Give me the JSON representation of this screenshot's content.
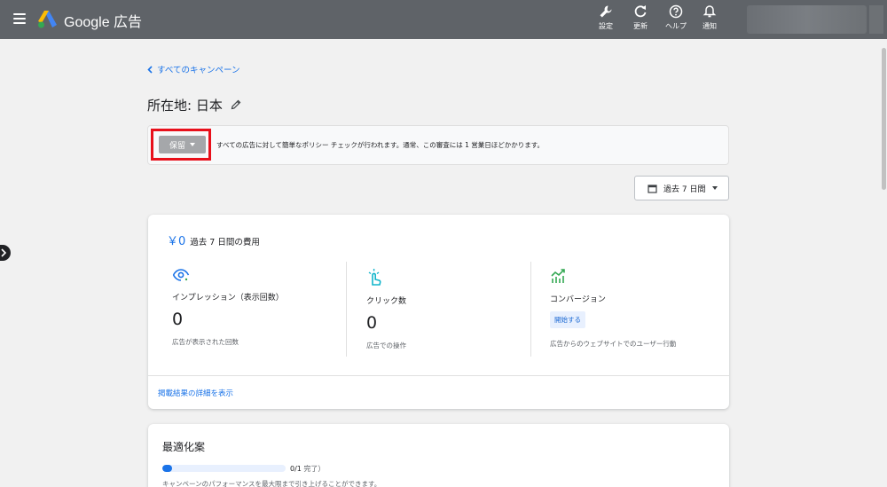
{
  "header": {
    "product_name": "Google 広告",
    "actions": [
      {
        "icon": "wrench-icon",
        "label": "設定"
      },
      {
        "icon": "refresh-icon",
        "label": "更新"
      },
      {
        "icon": "help-icon",
        "label": "ヘルプ"
      },
      {
        "icon": "bell-icon",
        "label": "通知"
      }
    ]
  },
  "nav": {
    "back_link": "すべてのキャンペーン"
  },
  "page": {
    "title": "所在地: 日本"
  },
  "status": {
    "button_label": "保留",
    "message": "すべての広告に対して簡単なポリシー チェックが行われます。通常、この審査には 1 営業日ほどかかります。"
  },
  "date_range": {
    "label": "過去 7 日間"
  },
  "summary": {
    "cost_value": "￥0",
    "cost_label": "過去 7 日間の費用",
    "metrics": [
      {
        "icon": "eye-icon",
        "name": "インプレッション（表示回数）",
        "value": "0",
        "desc": "広告が表示された回数"
      },
      {
        "icon": "click-icon",
        "name": "クリック数",
        "value": "0",
        "desc": "広告での操作"
      },
      {
        "icon": "conversion-chart-icon",
        "name": "コンバージョン",
        "badge": "開始する",
        "desc": "広告からのウェブサイトでのユーザー行動"
      }
    ],
    "details_link": "掲載結果の詳細を表示"
  },
  "optimization": {
    "title": "最適化案",
    "progress_fraction": 0.08,
    "progress_count": "0/1",
    "progress_suffix": " 完了）",
    "description": "キャンペーンのパフォーマンスを最大限まで引き上げることができます。"
  },
  "colors": {
    "accent": "#1a73e8",
    "topbar": "#5f6368",
    "highlight": "#e8101b"
  }
}
